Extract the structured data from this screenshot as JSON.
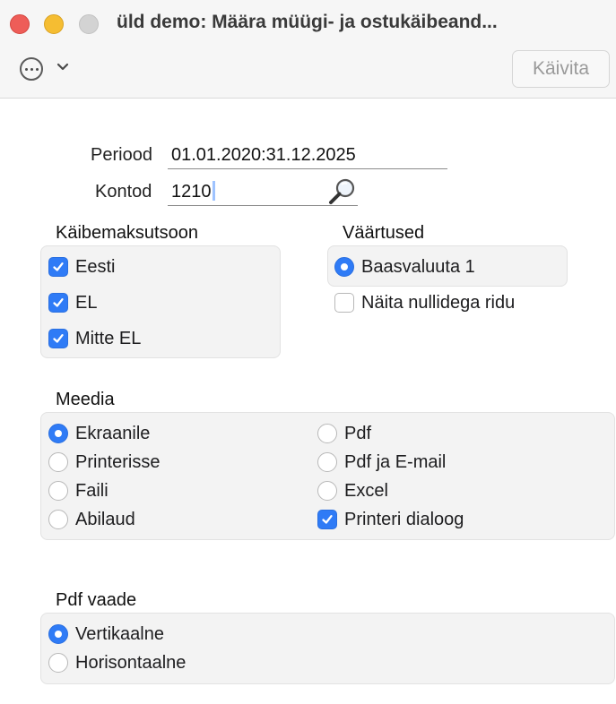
{
  "window": {
    "title": "üld demo: Määra müügi- ja ostukäibeand..."
  },
  "toolbar": {
    "more_icon": "ellipsis-circle-icon",
    "chevron_icon": "chevron-down-icon",
    "run_label": "Käivita"
  },
  "form": {
    "period_label": "Periood",
    "period_value": "01.01.2020:31.12.2025",
    "accounts_label": "Kontod",
    "accounts_value": "1210",
    "search_icon": "magnifier-icon"
  },
  "vat_zone": {
    "title": "Käibemaksutsoon",
    "items": [
      {
        "label": "Eesti",
        "checked": true
      },
      {
        "label": "EL",
        "checked": true
      },
      {
        "label": "Mitte EL",
        "checked": true
      }
    ]
  },
  "values": {
    "title": "Väärtused",
    "radio_label": "Baasvaluuta 1",
    "radio_selected": true,
    "checkbox_label": "Näita nullidega ridu",
    "checkbox_checked": false
  },
  "media": {
    "title": "Meedia",
    "left": [
      {
        "label": "Ekraanile",
        "selected": true
      },
      {
        "label": "Printerisse",
        "selected": false
      },
      {
        "label": "Faili",
        "selected": false
      },
      {
        "label": "Abilaud",
        "selected": false
      }
    ],
    "right": [
      {
        "label": "Pdf",
        "selected": false
      },
      {
        "label": "Pdf ja E-mail",
        "selected": false
      },
      {
        "label": "Excel",
        "selected": false
      }
    ],
    "printer_dialog_label": "Printeri dialoog",
    "printer_dialog_checked": true
  },
  "pdf_view": {
    "title": "Pdf vaade",
    "items": [
      {
        "label": "Vertikaalne",
        "selected": true
      },
      {
        "label": "Horisontaalne",
        "selected": false
      }
    ]
  },
  "colors": {
    "accent": "#2f7bf6",
    "close": "#ee5d58",
    "minimize": "#f5bd32",
    "disabled": "#d3d3d3"
  }
}
